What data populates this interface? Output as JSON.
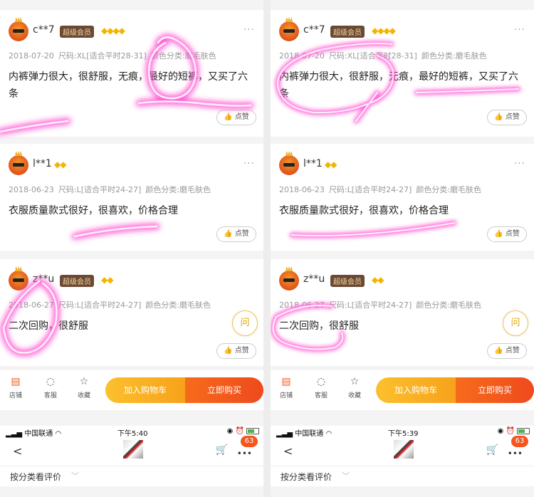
{
  "panels": [
    {
      "reviews": [
        {
          "user": "c**7",
          "vip": "超级会员",
          "diamonds": "◆◆◆◆",
          "date": "2018-07-20",
          "size": "尺码:XL[适合平时28-31]",
          "color": "颜色分类:磨毛肤色",
          "text": "内裤弹力很大，很舒服，无痕，最好的短裤，又买了六条",
          "like": "点赞"
        },
        {
          "user": "l**1",
          "vip": "",
          "diamonds": "◆◆",
          "date": "2018-06-23",
          "size": "尺码:L[适合平时24-27]",
          "color": "颜色分类:磨毛肤色",
          "text": "衣服质量款式很好，很喜欢，价格合理",
          "like": "点赞"
        },
        {
          "user": "z**u",
          "vip": "超级会员",
          "diamonds": "◆◆",
          "date": "2018-06-27",
          "size": "尺码:L[适合平时24-27]",
          "color": "颜色分类:磨毛肤色",
          "text": "二次回购，很舒服",
          "like": "点赞"
        }
      ],
      "ask": "问",
      "actions": {
        "shop": "店铺",
        "service": "客服",
        "favorite": "收藏",
        "add_cart": "加入购物车",
        "buy_now": "立即购买"
      },
      "status": {
        "carrier": "中国联通",
        "time": "下午5:40"
      },
      "cart_count": "63",
      "filter": "按分类看评价"
    },
    {
      "reviews": [
        {
          "user": "c**7",
          "vip": "超级会员",
          "diamonds": "◆◆◆◆",
          "date": "2018-07-20",
          "size": "尺码:XL[适合平时28-31]",
          "color": "颜色分类:磨毛肤色",
          "text": "内裤弹力很大，很舒服，无痕，最好的短裤，又买了六条",
          "like": "点赞"
        },
        {
          "user": "l**1",
          "vip": "",
          "diamonds": "◆◆",
          "date": "2018-06-23",
          "size": "尺码:L[适合平时24-27]",
          "color": "颜色分类:磨毛肤色",
          "text": "衣服质量款式很好，很喜欢，价格合理",
          "like": "点赞"
        },
        {
          "user": "z**u",
          "vip": "超级会员",
          "diamonds": "◆◆",
          "date": "2018-06-27",
          "size": "尺码:L[适合平时24-27]",
          "color": "颜色分类:磨毛肤色",
          "text": "二次回购，很舒服",
          "like": "点赞"
        }
      ],
      "ask": "问",
      "actions": {
        "shop": "店铺",
        "service": "客服",
        "favorite": "收藏",
        "add_cart": "加入购物车",
        "buy_now": "立即购买"
      },
      "status": {
        "carrier": "中国联通",
        "time": "下午5:39"
      },
      "cart_count": "63",
      "filter": "按分类看评价"
    }
  ],
  "colors": {
    "highlight": "#ff4fd0",
    "vip_bg": "#6a4a32",
    "cart_btn": "#fbc02d",
    "buy_btn": "#ef4a1d",
    "diamond": "#f4b400"
  }
}
